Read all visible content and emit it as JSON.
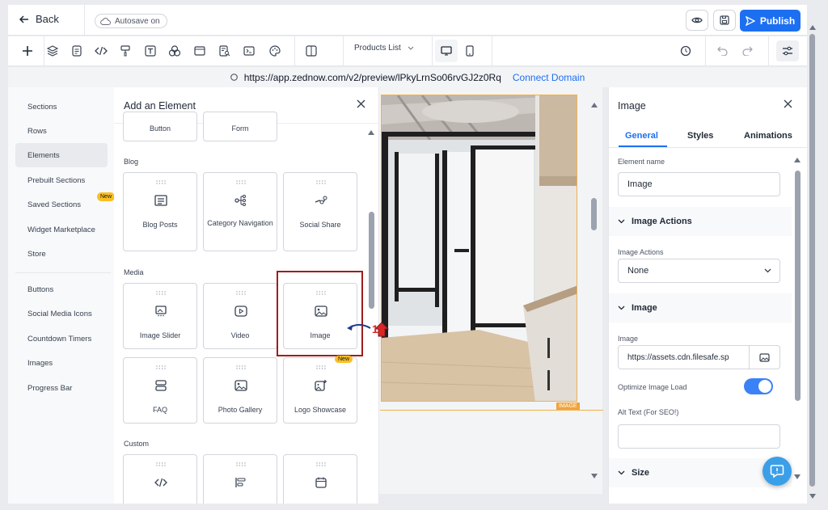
{
  "topbar": {
    "back_label": "Back",
    "autosave_label": "Autosave on",
    "preview_icon": "eye-icon",
    "save_icon": "save-icon",
    "publish_label": "Publish"
  },
  "toolbar": {
    "tools": [
      "plus-icon",
      "layers-icon",
      "page-icon",
      "code-icon",
      "paint-roller-icon",
      "text-icon",
      "components-icon",
      "section-icon",
      "page-search-icon",
      "terminal-icon",
      "palette-icon"
    ],
    "page_select": "Products List",
    "history_icon": "history-icon",
    "undo_icon": "undo-icon",
    "redo_icon": "redo-icon",
    "settings_icon": "sliders-icon"
  },
  "urlbar": {
    "url": "https://app.zednow.com/v2/preview/lPkyLrnSo06rvGJ2z0Rq",
    "connect_label": "Connect Domain"
  },
  "leftnav": {
    "items": [
      "Sections",
      "Rows",
      "Elements",
      "Prebuilt Sections",
      "Saved Sections",
      "Widget Marketplace",
      "Store"
    ],
    "active": "Elements",
    "new_badge": "New",
    "items2": [
      "Buttons",
      "Social Media Icons",
      "Countdown Timers",
      "Images",
      "Progress Bar"
    ]
  },
  "addpanel": {
    "title": "Add an Element",
    "top_cards": [
      "Button",
      "Form"
    ],
    "blog": {
      "heading": "Blog",
      "cards": [
        "Blog Posts",
        "Category Navigation",
        "Social Share"
      ]
    },
    "media": {
      "heading": "Media",
      "cards": [
        "Image Slider",
        "Video",
        "Image"
      ],
      "cards2": [
        "FAQ",
        "Photo Gallery",
        "Logo Showcase"
      ],
      "new_badge": "New"
    },
    "custom": {
      "heading": "Custom"
    }
  },
  "canvas": {
    "image_tag": "IMAGE"
  },
  "annotation": {
    "step_number": "1"
  },
  "rightpanel": {
    "title": "Image",
    "tabs": [
      "General",
      "Styles",
      "Animations"
    ],
    "active_tab": "General",
    "element_name_label": "Element name",
    "element_name_value": "Image",
    "image_actions_section": "Image Actions",
    "image_actions_label": "Image Actions",
    "image_actions_value": "None",
    "image_section": "Image",
    "image_label": "Image",
    "image_url": "https://assets.cdn.filesafe.sp",
    "optimize_label": "Optimize Image Load",
    "optimize_on": true,
    "alt_text_label": "Alt Text (For SEO!)",
    "alt_text_value": "",
    "size_section": "Size"
  },
  "colors": {
    "accent": "#1d6ff2",
    "highlight": "#a21c1c",
    "badge": "#fbbf24"
  }
}
